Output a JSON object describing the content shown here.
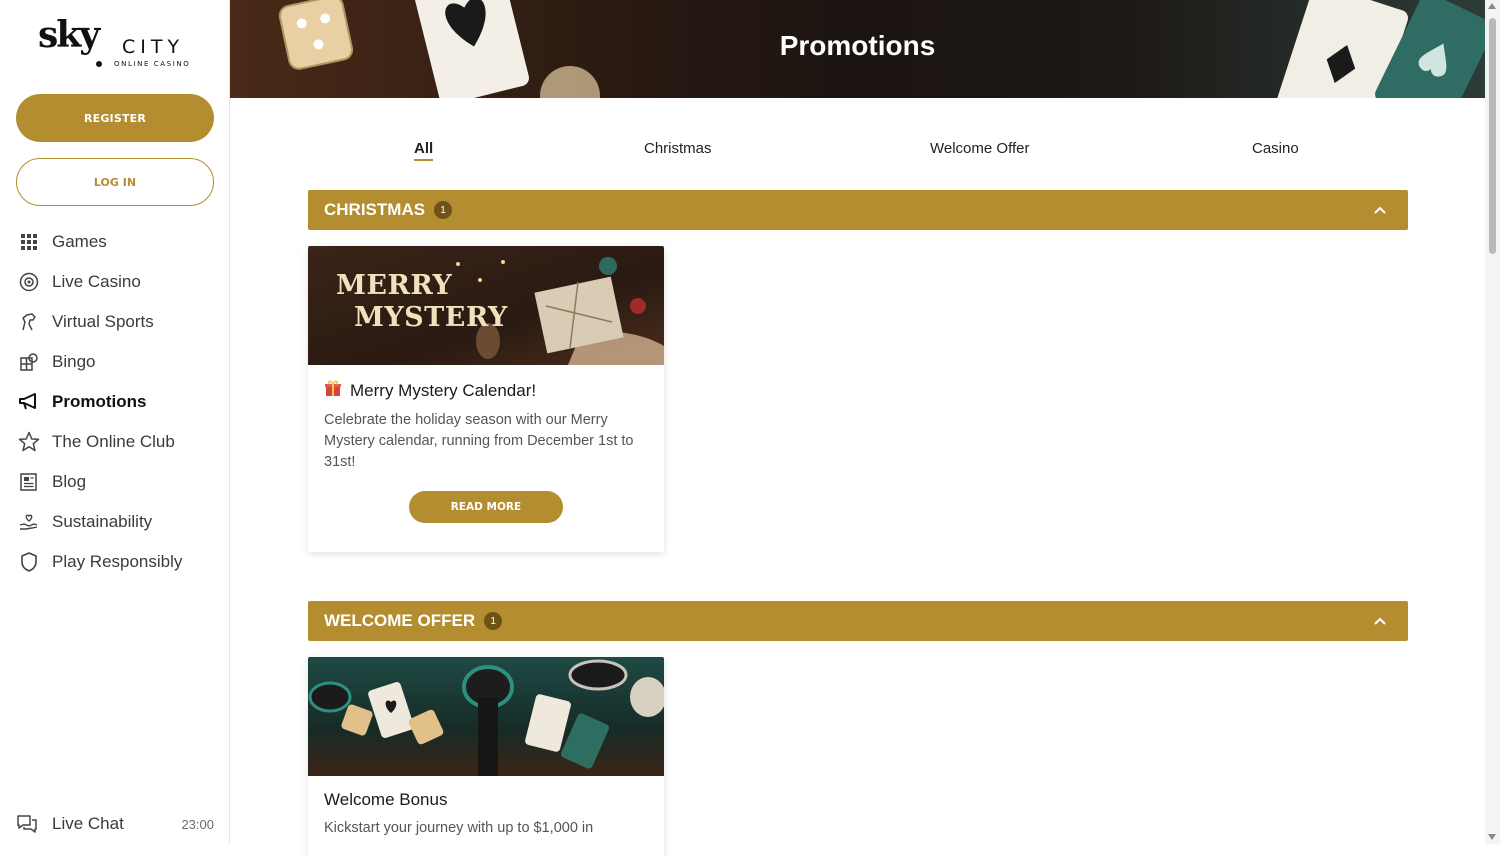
{
  "logo": {
    "sky": "sky",
    "city": "CITY",
    "sub": "ONLINE CASINO"
  },
  "sidebar": {
    "register_label": "REGISTER",
    "login_label": "LOG IN",
    "items": [
      {
        "label": "Games",
        "icon": "grid-icon"
      },
      {
        "label": "Live Casino",
        "icon": "roulette-icon"
      },
      {
        "label": "Virtual Sports",
        "icon": "horse-icon"
      },
      {
        "label": "Bingo",
        "icon": "bingo-icon"
      },
      {
        "label": "Promotions",
        "icon": "megaphone-icon",
        "active": true
      },
      {
        "label": "The Online Club",
        "icon": "star-icon"
      },
      {
        "label": "Blog",
        "icon": "newspaper-icon"
      },
      {
        "label": "Sustainability",
        "icon": "hand-heart-icon"
      },
      {
        "label": "Play Responsibly",
        "icon": "shield-icon"
      }
    ],
    "live_chat": {
      "label": "Live Chat",
      "time": "23:00"
    }
  },
  "hero": {
    "title": "Promotions"
  },
  "tabs": [
    {
      "label": "All",
      "active": true
    },
    {
      "label": "Christmas"
    },
    {
      "label": "Welcome Offer"
    },
    {
      "label": "Casino"
    }
  ],
  "sections": [
    {
      "title": "CHRISTMAS",
      "count": "1",
      "card": {
        "image_text": [
          "MERRY",
          "MYSTERY"
        ],
        "title": "Merry Mystery Calendar!",
        "description": "Celebrate the holiday season with our Merry Mystery calendar, running from December 1st to 31st!",
        "button": "READ MORE"
      }
    },
    {
      "title": "WELCOME OFFER",
      "count": "1",
      "card": {
        "title": "Welcome Bonus",
        "description": "Kickstart your journey with up to $1,000 in"
      }
    }
  ],
  "colors": {
    "accent": "#b38d2f",
    "badge": "#6e5318"
  }
}
